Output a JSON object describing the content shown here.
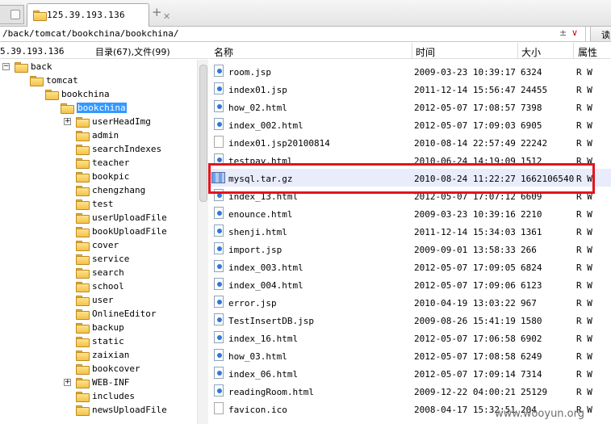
{
  "tabbar": {
    "tab_title": "125.39.193.136",
    "close_glyph": "✕",
    "new_tab_glyph": "+"
  },
  "address": {
    "path": "/back/tomcat/bookchina/bookchina/",
    "dropdown_glyph": "±",
    "go_glyph": "∨",
    "read_button": "读"
  },
  "left_panel": {
    "host": "5.39.193.136",
    "counts": "目录(67),文件(99)"
  },
  "tree": [
    {
      "label": "back",
      "expander": "−",
      "selected": false
    },
    {
      "label": "tomcat",
      "expander": "",
      "selected": false
    },
    {
      "label": "bookchina",
      "expander": "",
      "selected": false
    },
    {
      "label": "bookchina",
      "expander": "",
      "selected": true
    },
    {
      "label": "userHeadImg",
      "expander": "+",
      "selected": false
    },
    {
      "label": "admin",
      "expander": "",
      "selected": false
    },
    {
      "label": "searchIndexes",
      "expander": "",
      "selected": false
    },
    {
      "label": "teacher",
      "expander": "",
      "selected": false
    },
    {
      "label": "bookpic",
      "expander": "",
      "selected": false
    },
    {
      "label": "chengzhang",
      "expander": "",
      "selected": false
    },
    {
      "label": "test",
      "expander": "",
      "selected": false
    },
    {
      "label": "userUploadFile",
      "expander": "",
      "selected": false
    },
    {
      "label": "bookUploadFile",
      "expander": "",
      "selected": false
    },
    {
      "label": "cover",
      "expander": "",
      "selected": false
    },
    {
      "label": "service",
      "expander": "",
      "selected": false
    },
    {
      "label": "search",
      "expander": "",
      "selected": false
    },
    {
      "label": "school",
      "expander": "",
      "selected": false
    },
    {
      "label": "user",
      "expander": "",
      "selected": false
    },
    {
      "label": "OnlineEditor",
      "expander": "",
      "selected": false
    },
    {
      "label": "backup",
      "expander": "",
      "selected": false
    },
    {
      "label": "static",
      "expander": "",
      "selected": false
    },
    {
      "label": "zaixian",
      "expander": "",
      "selected": false
    },
    {
      "label": "bookcover",
      "expander": "",
      "selected": false
    },
    {
      "label": "WEB-INF",
      "expander": "+",
      "selected": false
    },
    {
      "label": "includes",
      "expander": "",
      "selected": false
    },
    {
      "label": "newsUploadFile",
      "expander": "",
      "selected": false
    }
  ],
  "columns": {
    "name": "名称",
    "time": "时间",
    "size": "大小",
    "attr": "属性"
  },
  "files": [
    {
      "name": "room.jsp",
      "time": "2009-03-23 10:39:17",
      "size": "6324",
      "attr": "R W",
      "icon": "doc-icon"
    },
    {
      "name": "index01.jsp",
      "time": "2011-12-14 15:56:47",
      "size": "24455",
      "attr": "R W",
      "icon": "doc-icon"
    },
    {
      "name": "how_02.html",
      "time": "2012-05-07 17:08:57",
      "size": "7398",
      "attr": "R W",
      "icon": "doc-icon"
    },
    {
      "name": "index_002.html",
      "time": "2012-05-07 17:09:03",
      "size": "6905",
      "attr": "R W",
      "icon": "doc-icon"
    },
    {
      "name": "index01.jsp20100814",
      "time": "2010-08-14 22:57:49",
      "size": "22242",
      "attr": "R W",
      "icon": "blank-file-icon"
    },
    {
      "name": "testpay.html",
      "time": "2010-06-24 14:19:09",
      "size": "1512",
      "attr": "R W",
      "icon": "doc-icon"
    },
    {
      "name": "mysql.tar.gz",
      "time": "2010-08-24 11:22:27",
      "size": "1662106540",
      "attr": "R W",
      "icon": "archive-icon"
    },
    {
      "name": "index_13.html",
      "time": "2012-05-07 17:07:12",
      "size": "6609",
      "attr": "R W",
      "icon": "doc-icon"
    },
    {
      "name": "enounce.html",
      "time": "2009-03-23 10:39:16",
      "size": "2210",
      "attr": "R W",
      "icon": "doc-icon"
    },
    {
      "name": "shenji.html",
      "time": "2011-12-14 15:34:03",
      "size": "1361",
      "attr": "R W",
      "icon": "doc-icon"
    },
    {
      "name": "import.jsp",
      "time": "2009-09-01 13:58:33",
      "size": "266",
      "attr": "R W",
      "icon": "doc-icon"
    },
    {
      "name": "index_003.html",
      "time": "2012-05-07 17:09:05",
      "size": "6824",
      "attr": "R W",
      "icon": "doc-icon"
    },
    {
      "name": "index_004.html",
      "time": "2012-05-07 17:09:06",
      "size": "6123",
      "attr": "R W",
      "icon": "doc-icon"
    },
    {
      "name": "error.jsp",
      "time": "2010-04-19 13:03:22",
      "size": "967",
      "attr": "R W",
      "icon": "doc-icon"
    },
    {
      "name": "TestInsertDB.jsp",
      "time": "2009-08-26 15:41:19",
      "size": "1580",
      "attr": "R W",
      "icon": "doc-icon"
    },
    {
      "name": "index_16.html",
      "time": "2012-05-07 17:06:58",
      "size": "6902",
      "attr": "R W",
      "icon": "doc-icon"
    },
    {
      "name": "how_03.html",
      "time": "2012-05-07 17:08:58",
      "size": "6249",
      "attr": "R W",
      "icon": "doc-icon"
    },
    {
      "name": "index_06.html",
      "time": "2012-05-07 17:09:14",
      "size": "7314",
      "attr": "R W",
      "icon": "doc-icon"
    },
    {
      "name": "readingRoom.html",
      "time": "2009-12-22 04:00:21",
      "size": "25129",
      "attr": "R W",
      "icon": "doc-icon"
    },
    {
      "name": "favicon.ico",
      "time": "2008-04-17 15:32:51",
      "size": "204",
      "attr": "R W",
      "icon": "blank-file-icon"
    }
  ],
  "watermark": "www.wooyun.org",
  "colors": {
    "selection": "#3399ff",
    "highlight_box": "#e3141c",
    "row_highlight": "#e8ecfb"
  }
}
